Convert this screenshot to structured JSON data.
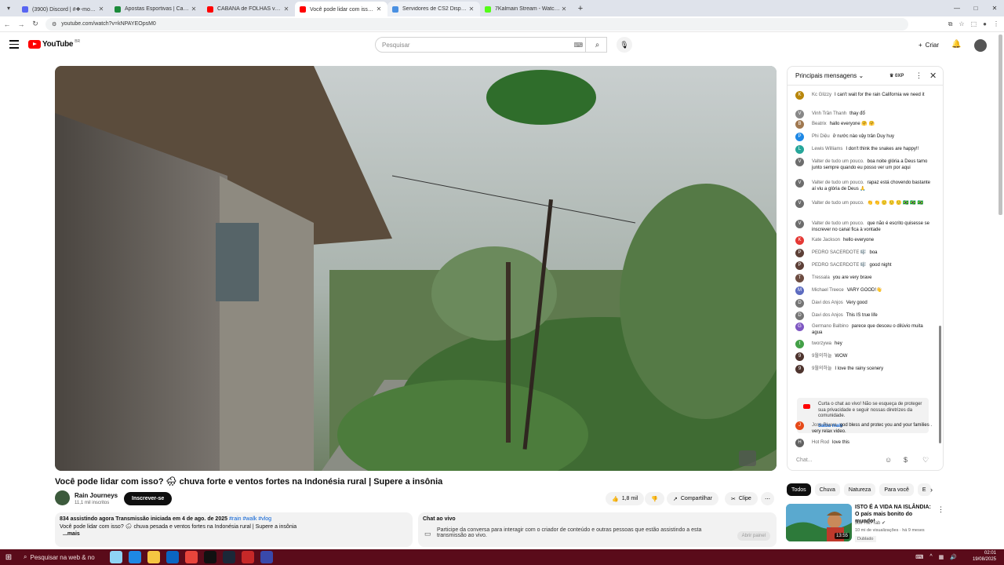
{
  "browser": {
    "tabs": [
      {
        "title": "(3900) Discord | #❖-mochilas",
        "color": "#5865f2",
        "active": false
      },
      {
        "title": "Apostas Esportivas | Casa de Ap",
        "color": "#1b8a3a",
        "active": false
      },
      {
        "title": "CABANA de FOLHAS vs TEMPES",
        "color": "#ff0000",
        "active": false
      },
      {
        "title": "Você pode lidar com isso? 🌧",
        "color": "#ff0000",
        "active": true
      },
      {
        "title": "Servidores de CS2 Disponíveis",
        "color": "#4a90e2",
        "active": false,
        "hover": true
      },
      {
        "title": "7Kalmain Stream - Watch Live",
        "color": "#53fc18",
        "active": false
      }
    ],
    "url": "youtube.com/watch?v=kNPAYEOpsM0"
  },
  "header": {
    "logo_text": "YouTube",
    "logo_region": "BR",
    "search_placeholder": "Pesquisar",
    "create_label": "Criar"
  },
  "video": {
    "title": "Você pode lidar com isso? 🌧 chuva forte e ventos fortes na Indonésia rural | Supere a insônia",
    "channel": "Rain Journeys",
    "subscribers": "11,1 mil inscritos",
    "subscribe_label": "Inscrever-se",
    "likes": "1,8 mil",
    "share_label": "Compartilhar",
    "clip_label": "Clipe",
    "watching": "834 assistindo agora",
    "started": "Transmissão iniciada em 4 de ago. de 2025",
    "tags": "#rain #walk #vlog",
    "desc_line": "Você pode lidar com isso? 🌧 chuva pesada e ventos fortes na Indonésia rural | Supere a insônia",
    "more": "...mais"
  },
  "livechat_box": {
    "title": "Chat ao vivo",
    "body": "Participe da conversa para interagir com o criador de conteúdo e outras pessoas que estão assistindo a esta transmissão ao vivo.",
    "button": "Abrir painel"
  },
  "chat": {
    "header": "Principais mensagens",
    "xp": "0XP",
    "messages": [
      {
        "author": "Kc Glizzy",
        "text": "I can't wait for the rain California we need it",
        "color": "#b8860b",
        "initial": "K"
      },
      {
        "author": "Vinh Trần Thanh",
        "text": "thay đổ",
        "color": "#888888",
        "initial": "V"
      },
      {
        "author": "Beatrix",
        "text": "hallo everyone 🤗 🤗",
        "color": "#a07850",
        "initial": "B"
      },
      {
        "author": "Phi Diệu",
        "text": "ở nước nào vậy trân Duy huy",
        "color": "#1e88e5",
        "initial": "P"
      },
      {
        "author": "Lewis Williams",
        "text": "I don't think the snakes are happy!!",
        "color": "#26a69a",
        "initial": "L"
      },
      {
        "author": "Valter de tudo um pouco.",
        "text": "boa noite glória a Deus tamo junto sempre quando eu posso ver um por aqui",
        "color": "#6d6d6d",
        "initial": "V"
      },
      {
        "author": "Valter de tudo um pouco.",
        "text": "rapaz está chovendo bastante aí viu a glória de Deus 🙏",
        "color": "#6d6d6d",
        "initial": "V"
      },
      {
        "author": "Valter de tudo um pouco.",
        "text": "👏 👏 🙂 🙂 🙂 🇧🇷 🇧🇷 🇧🇷",
        "color": "#6d6d6d",
        "initial": "V"
      },
      {
        "author": "Valter de tudo um pouco.",
        "text": "que não é escrito quisesse se inscrever no canal fica à vontade",
        "color": "#6d6d6d",
        "initial": "V"
      },
      {
        "author": "Kate Jackson",
        "text": "hello everyone",
        "color": "#e53935",
        "initial": "K"
      },
      {
        "author": "PEDRO SACERDOTE 🎼",
        "text": "boa",
        "color": "#5d4037",
        "initial": "P"
      },
      {
        "author": "PEDRO SACERDOTE 🎼",
        "text": "good night",
        "color": "#5d4037",
        "initial": "P"
      },
      {
        "author": "Tressala",
        "text": "you are very brave",
        "color": "#6d4c41",
        "initial": "T"
      },
      {
        "author": "Michael Treece",
        "text": "VARY GOOD!👋",
        "color": "#5c6bc0",
        "initial": "M"
      },
      {
        "author": "Davi dos Anjos",
        "text": "Very good",
        "color": "#757575",
        "initial": "D"
      },
      {
        "author": "Davi dos Anjos",
        "text": "This IS true life",
        "color": "#757575",
        "initial": "D"
      },
      {
        "author": "Germano Balbino",
        "text": "parece que desceu o dilúvio muita agua",
        "color": "#7e57c2",
        "initial": "G"
      },
      {
        "author": "tworzywa",
        "text": "hey",
        "color": "#43a047",
        "initial": "t"
      },
      {
        "author": "9월의하늘",
        "text": "WOW",
        "color": "#4e342e",
        "initial": "9"
      },
      {
        "author": "9월의하늘",
        "text": "I love the rainy scenery",
        "color": "#4e342e",
        "initial": "9"
      },
      {
        "author": "Jose Rivera",
        "text": "god bless and protec you and your families . very relax video.",
        "color": "#e64a19",
        "initial": "J"
      },
      {
        "author": "Hot Rod",
        "text": "love this",
        "color": "#616161",
        "initial": "H"
      }
    ],
    "notice": "Curta o chat ao vivo! Não se esqueça de proteger sua privacidade e seguir nossas diretrizes da comunidade.",
    "notice_link": "Saiba mais",
    "input_placeholder": "Chat..."
  },
  "chips": [
    "Todos",
    "Chuva",
    "Natureza",
    "Para você",
    "E"
  ],
  "recommendation": {
    "title": "ISTO É A VIDA NA ISLÂNDIA: O país mais bonito do mundo!",
    "channel": "Joe HaTTab ✔",
    "meta": "10 mi de visualizações · há 9 meses",
    "badge": "Dublado",
    "duration": "13:55"
  },
  "taskbar": {
    "search": "Pesquisar na web & no",
    "time": "02:01",
    "date": "19/08/2025"
  }
}
